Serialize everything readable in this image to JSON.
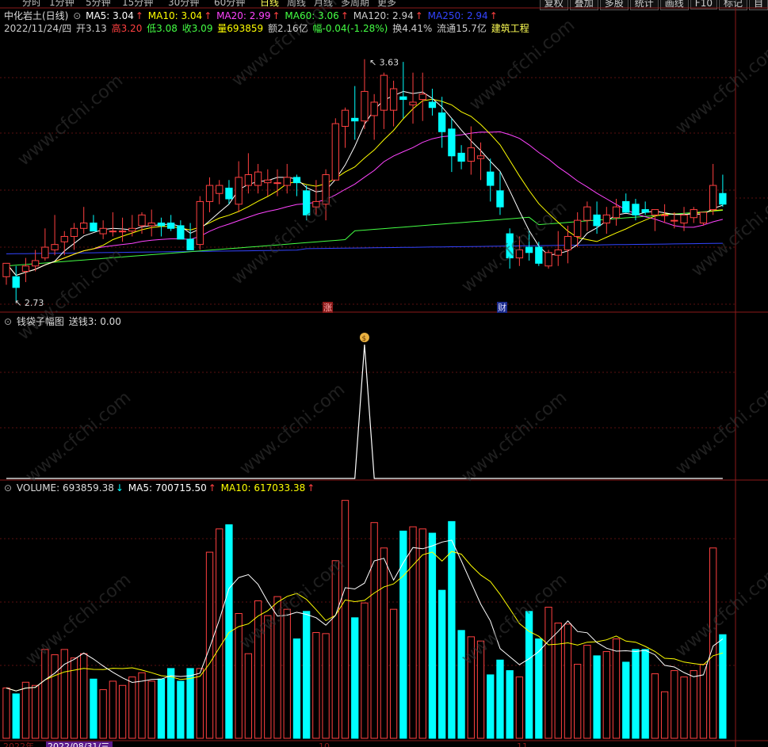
{
  "toolbar": {
    "tabs": [
      "分时",
      "1分钟",
      "5分钟",
      "15分钟",
      "30分钟",
      "60分钟",
      "日线",
      "周线",
      "月线",
      "多周期",
      "更多"
    ],
    "active": "日线",
    "right_buttons": [
      "复权",
      "叠加",
      "多股",
      "统计",
      "画线",
      "F10",
      "标记",
      "自"
    ]
  },
  "main": {
    "title": "中化岩土(日线)",
    "ma": [
      {
        "label": "MA5: 3.04",
        "color": "#ffffff"
      },
      {
        "label": "MA10: 3.04",
        "color": "#ffff00"
      },
      {
        "label": "MA20: 2.99",
        "color": "#ff44ff"
      },
      {
        "label": "MA60: 3.06",
        "color": "#44ff44"
      },
      {
        "label": "MA120: 2.94",
        "color": "#cccccc"
      },
      {
        "label": "MA250: 2.94",
        "color": "#3344ff"
      }
    ],
    "info": {
      "date": "2022/11/24/四",
      "open": "开3.13",
      "high": "高3.20",
      "low": "低3.08",
      "close": "收3.09",
      "vol": "量693859",
      "amount": "额2.16亿",
      "change": "幅-0.04(-1.28%)",
      "turnover": "换4.41%",
      "float": "流通15.7亿",
      "sector": "建筑工程"
    },
    "high_mark": "3.63",
    "low_mark": "2.73",
    "badge_zhang": "涨",
    "badge_cai": "财"
  },
  "indicator": {
    "title": "钱袋子幅图",
    "value": "送钱3: 0.00",
    "icon": "money-bag-icon"
  },
  "volume_panel": {
    "title": "VOLUME: 693859.38",
    "ma5": "MA5: 700715.50",
    "ma10": "MA10: 617033.38"
  },
  "bottom_axis": {
    "labels": [
      "2022年",
      "2022/08/31/三",
      "10",
      "11"
    ]
  },
  "colors": {
    "up": "#ff4040",
    "down": "#00ffff",
    "ma5": "#ffffff",
    "ma10": "#ffff00",
    "ma20": "#ff44ff",
    "ma60": "#44ff44",
    "ma250": "#3344ff",
    "grid": "#5a1010"
  },
  "chart_data": {
    "type": "candlestick",
    "dates_shown": [
      "2022/08/31/三",
      "10",
      "11"
    ],
    "ylim": [
      2.7,
      3.7
    ],
    "candles": [
      [
        2.82,
        2.87,
        2.79,
        2.87
      ],
      [
        2.82,
        2.86,
        2.73,
        2.78
      ],
      [
        2.84,
        2.89,
        2.8,
        2.86
      ],
      [
        2.86,
        2.92,
        2.84,
        2.88
      ],
      [
        2.89,
        3.0,
        2.88,
        2.93
      ],
      [
        2.92,
        3.05,
        2.9,
        2.94
      ],
      [
        2.95,
        2.99,
        2.9,
        2.97
      ],
      [
        2.97,
        3.02,
        2.92,
        3.0
      ],
      [
        3.0,
        3.08,
        2.98,
        3.02
      ],
      [
        3.02,
        3.05,
        2.99,
        2.99
      ],
      [
        2.98,
        3.03,
        2.96,
        3.0
      ],
      [
        2.99,
        3.06,
        2.97,
        2.99
      ],
      [
        2.99,
        3.04,
        2.95,
        2.99
      ],
      [
        2.99,
        3.05,
        2.97,
        3.0
      ],
      [
        3.01,
        3.06,
        2.98,
        3.05
      ],
      [
        3.01,
        3.07,
        2.97,
        3.02
      ],
      [
        3.02,
        3.04,
        2.97,
        3.01
      ],
      [
        3.02,
        3.05,
        2.99,
        3.0
      ],
      [
        3.01,
        3.03,
        2.97,
        2.96
      ],
      [
        2.96,
        3.02,
        2.93,
        2.92
      ],
      [
        2.94,
        3.12,
        2.92,
        3.1
      ],
      [
        3.1,
        3.19,
        3.06,
        3.16
      ],
      [
        3.13,
        3.18,
        3.09,
        3.16
      ],
      [
        3.15,
        3.18,
        3.09,
        3.11
      ],
      [
        3.09,
        3.25,
        3.06,
        3.19
      ],
      [
        3.16,
        3.28,
        3.13,
        3.2
      ],
      [
        3.16,
        3.24,
        3.13,
        3.21
      ],
      [
        3.17,
        3.22,
        3.12,
        3.18
      ],
      [
        3.17,
        3.22,
        3.12,
        3.17
      ],
      [
        3.16,
        3.24,
        3.13,
        3.19
      ],
      [
        3.19,
        3.2,
        3.12,
        3.17
      ],
      [
        3.14,
        3.16,
        3.03,
        3.05
      ],
      [
        3.08,
        3.18,
        3.05,
        3.1
      ],
      [
        3.09,
        3.22,
        3.03,
        3.2
      ],
      [
        3.18,
        3.41,
        3.18,
        3.39
      ],
      [
        3.38,
        3.45,
        3.3,
        3.44
      ],
      [
        3.41,
        3.53,
        3.33,
        3.4
      ],
      [
        3.4,
        3.63,
        3.37,
        3.51
      ],
      [
        3.42,
        3.5,
        3.33,
        3.47
      ],
      [
        3.44,
        3.58,
        3.37,
        3.57
      ],
      [
        3.44,
        3.55,
        3.38,
        3.52
      ],
      [
        3.49,
        3.62,
        3.41,
        3.48
      ],
      [
        3.46,
        3.58,
        3.39,
        3.47
      ],
      [
        3.48,
        3.58,
        3.4,
        3.5
      ],
      [
        3.47,
        3.52,
        3.42,
        3.45
      ],
      [
        3.43,
        3.49,
        3.3,
        3.36
      ],
      [
        3.37,
        3.41,
        3.21,
        3.27
      ],
      [
        3.28,
        3.31,
        3.22,
        3.25
      ],
      [
        3.25,
        3.38,
        3.2,
        3.3
      ],
      [
        3.26,
        3.32,
        3.18,
        3.27
      ],
      [
        3.21,
        3.26,
        3.1,
        3.16
      ],
      [
        3.14,
        3.21,
        3.05,
        3.08
      ],
      [
        2.98,
        3.0,
        2.85,
        2.89
      ],
      [
        2.89,
        2.97,
        2.86,
        2.92
      ],
      [
        2.93,
        2.99,
        2.88,
        2.91
      ],
      [
        2.93,
        2.95,
        2.86,
        2.87
      ],
      [
        2.86,
        2.92,
        2.85,
        2.91
      ],
      [
        2.9,
        2.99,
        2.86,
        2.92
      ],
      [
        2.92,
        3.01,
        2.87,
        2.97
      ],
      [
        2.97,
        3.06,
        2.93,
        3.03
      ],
      [
        3.03,
        3.1,
        2.99,
        3.08
      ],
      [
        3.05,
        3.1,
        2.98,
        3.01
      ],
      [
        3.02,
        3.08,
        2.98,
        3.05
      ],
      [
        3.04,
        3.11,
        3.01,
        3.08
      ],
      [
        3.1,
        3.13,
        3.06,
        3.06
      ],
      [
        3.09,
        3.11,
        3.03,
        3.05
      ],
      [
        3.07,
        3.1,
        3.05,
        3.06
      ],
      [
        3.05,
        3.07,
        2.99,
        3.07
      ],
      [
        3.05,
        3.09,
        3.02,
        3.05
      ],
      [
        3.03,
        3.06,
        3.0,
        3.03
      ],
      [
        3.02,
        3.08,
        2.99,
        3.05
      ],
      [
        3.04,
        3.08,
        3.02,
        3.07
      ],
      [
        3.02,
        3.06,
        3.01,
        3.06
      ],
      [
        3.07,
        3.24,
        3.05,
        3.16
      ],
      [
        3.13,
        3.2,
        3.08,
        3.09
      ]
    ],
    "volume": [
      238,
      210,
      265,
      250,
      420,
      395,
      420,
      380,
      400,
      280,
      230,
      270,
      250,
      290,
      310,
      270,
      280,
      330,
      270,
      330,
      330,
      880,
      990,
      1010,
      590,
      400,
      650,
      580,
      670,
      610,
      470,
      600,
      500,
      495,
      840,
      1125,
      570,
      640,
      1020,
      900,
      610,
      980,
      1000,
      990,
      970,
      700,
      1025,
      510,
      480,
      460,
      300,
      370,
      320,
      290,
      600,
      470,
      620,
      545,
      540,
      350,
      440,
      390,
      410,
      470,
      360,
      420,
      420,
      305,
      220,
      320,
      290,
      320,
      350,
      900,
      490
    ],
    "money_bag_signal_index": 37,
    "money_bag_signal_value": 3.0
  }
}
